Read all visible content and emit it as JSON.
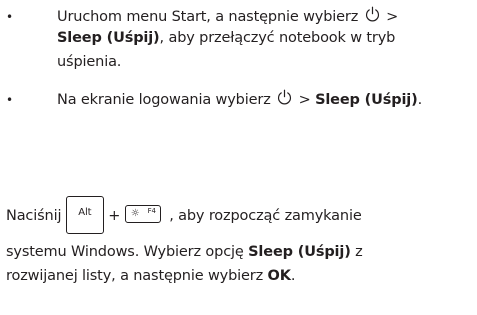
{
  "bullet_symbol": "•",
  "bullets": [
    {
      "line1_text": "Uruchom menu Start, a następnie wybierz",
      "line1_after": ">",
      "line2_bold": "Sleep (Uśpij)",
      "line2_rest": ", aby przełączyć notebook w tryb",
      "line3": "uśpienia.",
      "icon": "power-icon"
    },
    {
      "text_before": "Na ekranie logowania wybierz",
      "text_after": ">",
      "bold": "Sleep (Uśpij)",
      "end": ".",
      "icon": "power-icon"
    }
  ],
  "shortcut": {
    "prefix": "Naciśnij",
    "key_alt_label": "Alt",
    "plus": "+",
    "key_f4_symbol": "☼",
    "key_f4_label": "F4",
    "suffix": ", aby rozpocząć zamykanie",
    "line2_text": "systemu Windows. Wybierz opcję",
    "line2_bold": "Sleep (Uśpij)",
    "line2_end": "z",
    "line3_text": "rozwijanej listy, a następnie wybierz",
    "line3_bold": "OK",
    "line3_end": "."
  }
}
